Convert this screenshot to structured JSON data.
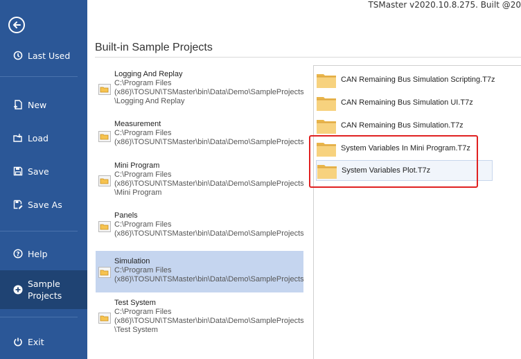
{
  "app": {
    "title": "TSMaster v2020.10.8.275. Built @20"
  },
  "sidebar": {
    "back_icon": "back-arrow-icon",
    "items": [
      {
        "label": "Last Used",
        "icon": "history-icon"
      },
      {
        "label": "New",
        "icon": "new-file-icon"
      },
      {
        "label": "Load",
        "icon": "load-folder-icon"
      },
      {
        "label": "Save",
        "icon": "save-disk-icon"
      },
      {
        "label": "Save As",
        "icon": "save-as-icon"
      },
      {
        "label": "Help",
        "icon": "help-icon"
      },
      {
        "label": "Sample Projects",
        "icon": "plus-circle-icon"
      },
      {
        "label": "Exit",
        "icon": "power-icon"
      }
    ],
    "selected": "Sample Projects"
  },
  "main": {
    "section_title": "Built-in Sample Projects",
    "categories": [
      {
        "name": "Logging And Replay",
        "path": "C:\\Program Files\n(x86)\\TOSUN\\TSMaster\\bin\\Data\\Demo\\SampleProjects\n\\Logging And Replay"
      },
      {
        "name": "Measurement",
        "path": "C:\\Program Files\n(x86)\\TOSUN\\TSMaster\\bin\\Data\\Demo\\SampleProjects"
      },
      {
        "name": "Mini Program",
        "path": "C:\\Program Files\n(x86)\\TOSUN\\TSMaster\\bin\\Data\\Demo\\SampleProjects\n\\Mini Program"
      },
      {
        "name": "Panels",
        "path": "C:\\Program Files\n(x86)\\TOSUN\\TSMaster\\bin\\Data\\Demo\\SampleProjects"
      },
      {
        "name": "Simulation",
        "path": "C:\\Program Files\n(x86)\\TOSUN\\TSMaster\\bin\\Data\\Demo\\SampleProjects"
      },
      {
        "name": "Test System",
        "path": "C:\\Program Files\n(x86)\\TOSUN\\TSMaster\\bin\\Data\\Demo\\SampleProjects\n\\Test System"
      }
    ],
    "selected_category": "Simulation",
    "files": [
      {
        "name": "CAN Remaining Bus Simulation Scripting.T7z"
      },
      {
        "name": "CAN Remaining Bus Simulation UI.T7z"
      },
      {
        "name": "CAN Remaining Bus Simulation.T7z"
      },
      {
        "name": "System Variables In Mini Program.T7z"
      },
      {
        "name": "System Variables Plot.T7z"
      }
    ],
    "hovered_file": "System Variables Plot.T7z",
    "highlight_color": "#e02020",
    "accent_color": "#2b5797"
  }
}
